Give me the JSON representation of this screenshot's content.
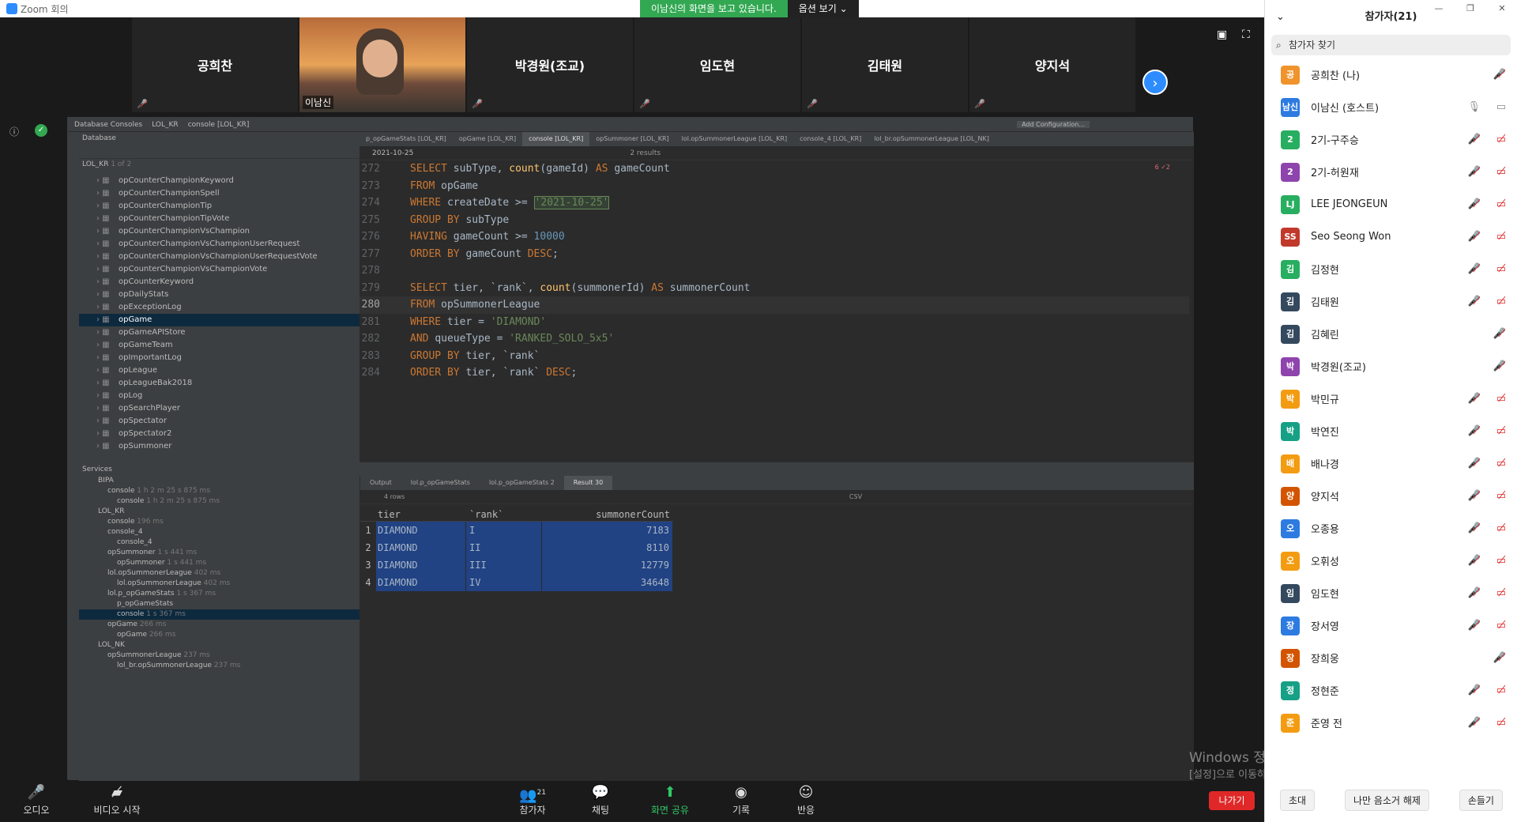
{
  "window": {
    "title": "Zoom 회의"
  },
  "share_banner": {
    "text": "이남신의 화면을 보고 있습니다.",
    "options": "옵션 보기"
  },
  "panel_window_controls": {
    "min": "—",
    "max": "❐",
    "close": "✕"
  },
  "video_tiles": [
    {
      "name": "공희찬",
      "video": false
    },
    {
      "name": "이남신",
      "video": true
    },
    {
      "name": "박경원(조교)",
      "video": false
    },
    {
      "name": "임도현",
      "video": false
    },
    {
      "name": "김태원",
      "video": false
    },
    {
      "name": "양지석",
      "video": false
    }
  ],
  "ide": {
    "breadcrumb": [
      "Database Consoles",
      "LOL_KR",
      "console [LOL_KR]"
    ],
    "add_config": "Add Configuration...",
    "db_panel_title": "Database",
    "db_root": "LOL_KR",
    "db_root_count": "1 of 2",
    "tables": [
      "opCounterChampionKeyword",
      "opCounterChampionSpell",
      "opCounterChampionTip",
      "opCounterChampionTipVote",
      "opCounterChampionVsChampion",
      "opCounterChampionVsChampionUserRequest",
      "opCounterChampionVsChampionUserRequestVote",
      "opCounterChampionVsChampionVote",
      "opCounterKeyword",
      "opDailyStats",
      "opExceptionLog",
      "opGame",
      "opGameAPIStore",
      "opGameTeam",
      "opImportantLog",
      "opLeague",
      "opLeagueBak2018",
      "opLog",
      "opSearchPlayer",
      "opSpectator",
      "opSpectator2",
      "opSummoner"
    ],
    "tabs": [
      "p_opGameStats [LOL_KR]",
      "opGame [LOL_KR]",
      "console [LOL_KR]",
      "opSummoner [LOL_KR]",
      "lol.opSummonerLeague [LOL_KR]",
      "console_4 [LOL_KR]",
      "lol_br.opSummonerLeague [LOL_NK]"
    ],
    "search_value": "2021-10-25",
    "search_results": "2 results",
    "inspection": "6 ✓2",
    "code_lines": [
      {
        "n": "272",
        "parts": [
          [
            "kw",
            "SELECT "
          ],
          [
            "",
            "subType, "
          ],
          [
            "fn",
            "count"
          ],
          [
            "",
            "(gameId) "
          ],
          [
            "kw",
            "AS "
          ],
          [
            "",
            "gameCount"
          ]
        ]
      },
      {
        "n": "273",
        "parts": [
          [
            "kw",
            "FROM "
          ],
          [
            "",
            "opGame"
          ]
        ]
      },
      {
        "n": "274",
        "parts": [
          [
            "kw",
            "WHERE "
          ],
          [
            "",
            "createDate >= "
          ],
          [
            "st hl",
            "'2021-10-25'"
          ]
        ]
      },
      {
        "n": "275",
        "parts": [
          [
            "kw",
            "GROUP BY "
          ],
          [
            "",
            "subType"
          ]
        ]
      },
      {
        "n": "276",
        "parts": [
          [
            "kw",
            "HAVING "
          ],
          [
            "",
            "gameCount >= "
          ],
          [
            "nm2",
            "10000"
          ]
        ]
      },
      {
        "n": "277",
        "parts": [
          [
            "kw",
            "ORDER BY "
          ],
          [
            "",
            "gameCount "
          ],
          [
            "kw",
            "DESC"
          ],
          [
            "",
            ";"
          ]
        ]
      },
      {
        "n": "278",
        "parts": []
      },
      {
        "n": "279",
        "parts": [
          [
            "kw",
            "SELECT "
          ],
          [
            "",
            "tier, `rank`, "
          ],
          [
            "fn",
            "count"
          ],
          [
            "",
            "(summonerId) "
          ],
          [
            "kw",
            "AS "
          ],
          [
            "",
            "summonerCount"
          ]
        ]
      },
      {
        "n": "280",
        "parts": [
          [
            "kw",
            "FROM "
          ],
          [
            "",
            "opSummonerLeague"
          ]
        ]
      },
      {
        "n": "281",
        "parts": [
          [
            "kw",
            "WHERE "
          ],
          [
            "",
            "tier = "
          ],
          [
            "st",
            "'DIAMOND'"
          ]
        ]
      },
      {
        "n": "282",
        "parts": [
          [
            "kw",
            "AND "
          ],
          [
            "",
            "queueType = "
          ],
          [
            "st",
            "'RANKED_SOLO_5x5'"
          ]
        ]
      },
      {
        "n": "283",
        "parts": [
          [
            "kw",
            "GROUP BY "
          ],
          [
            "",
            "tier, `rank`"
          ]
        ]
      },
      {
        "n": "284",
        "parts": [
          [
            "kw",
            "ORDER BY "
          ],
          [
            "",
            "tier, `rank` "
          ],
          [
            "kw",
            "DESC"
          ],
          [
            "",
            ";"
          ]
        ]
      }
    ],
    "services_title": "Services",
    "services": [
      {
        "d": 1,
        "label": "BIPA",
        "t": ""
      },
      {
        "d": 2,
        "label": "console",
        "t": "1 h 2 m 25 s 875 ms"
      },
      {
        "d": 3,
        "label": "console",
        "t": "1 h 2 m 25 s 875 ms"
      },
      {
        "d": 1,
        "label": "LOL_KR",
        "t": ""
      },
      {
        "d": 2,
        "label": "console",
        "t": "196 ms"
      },
      {
        "d": 2,
        "label": "console_4",
        "t": ""
      },
      {
        "d": 3,
        "label": "console_4",
        "t": ""
      },
      {
        "d": 2,
        "label": "opSummoner",
        "t": "1 s 441 ms"
      },
      {
        "d": 3,
        "label": "opSummoner",
        "t": "1 s 441 ms"
      },
      {
        "d": 2,
        "label": "lol.opSummonerLeague",
        "t": "402 ms"
      },
      {
        "d": 3,
        "label": "lol.opSummonerLeague",
        "t": "402 ms"
      },
      {
        "d": 2,
        "label": "lol.p_opGameStats",
        "t": "1 s 367 ms"
      },
      {
        "d": 3,
        "label": "p_opGameStats",
        "t": ""
      },
      {
        "d": 3,
        "label": "console",
        "t": "1 s 367 ms",
        "sel": true
      },
      {
        "d": 2,
        "label": "opGame",
        "t": "266 ms"
      },
      {
        "d": 3,
        "label": "opGame",
        "t": "266 ms"
      },
      {
        "d": 1,
        "label": "LOL_NK",
        "t": ""
      },
      {
        "d": 2,
        "label": "opSummonerLeague",
        "t": "237 ms"
      },
      {
        "d": 3,
        "label": "lol_br.opSummonerLeague",
        "t": "237 ms"
      }
    ],
    "result_tabs": [
      "Output",
      "lol.p_opGameStats",
      "lol.p_opGameStats 2",
      "Result 30"
    ],
    "rows_label": "4 rows",
    "export": "CSV",
    "columns": [
      "tier",
      "`rank`",
      "summonerCount"
    ],
    "rows": [
      [
        "1",
        "DIAMOND",
        "I",
        "7183"
      ],
      [
        "2",
        "DIAMOND",
        "II",
        "8110"
      ],
      [
        "3",
        "DIAMOND",
        "III",
        "12779"
      ],
      [
        "4",
        "DIAMOND",
        "IV",
        "34648"
      ]
    ]
  },
  "watermark": {
    "line1": "Windows 정품 인증",
    "line2": "[설정]으로 이동하여 Windows를 정품 인증합니다."
  },
  "bottom_bar": {
    "audio": "오디오",
    "video": "비디오 시작",
    "participants": "참가자",
    "participant_count": "21",
    "chat": "채팅",
    "share": "화면 공유",
    "record": "기록",
    "reactions": "반응",
    "leave": "나가기"
  },
  "panel": {
    "title": "참가자(21)",
    "search_placeholder": "참가자 찾기",
    "participants": [
      {
        "av": "공",
        "name": "공희찬 (나)",
        "color": "#f0932b",
        "cam": false
      },
      {
        "av": "남신",
        "name": "이남신 (호스트)",
        "color": "#2d7be0",
        "cam": false,
        "host": true
      },
      {
        "av": "2",
        "name": "2기-구주승",
        "color": "#27ae60",
        "cam": true
      },
      {
        "av": "2",
        "name": "2기-허원재",
        "color": "#8e44ad",
        "cam": true
      },
      {
        "av": "LJ",
        "name": "LEE JEONGEUN",
        "color": "#27ae60",
        "cam": true
      },
      {
        "av": "SS",
        "name": "Seo Seong Won",
        "color": "#c0392b",
        "cam": true
      },
      {
        "av": "김",
        "name": "김정현",
        "color": "#27ae60",
        "cam": true
      },
      {
        "av": "김",
        "name": "김태원",
        "color": "#34495e",
        "cam": true
      },
      {
        "av": "김",
        "name": "김혜린",
        "color": "#34495e",
        "cam": false
      },
      {
        "av": "박",
        "name": "박경원(조교)",
        "color": "#8e44ad",
        "cam": false
      },
      {
        "av": "박",
        "name": "박민규",
        "color": "#f39c12",
        "cam": true
      },
      {
        "av": "박",
        "name": "박연진",
        "color": "#16a085",
        "cam": true
      },
      {
        "av": "배",
        "name": "배나경",
        "color": "#f39c12",
        "cam": true
      },
      {
        "av": "양",
        "name": "양지석",
        "color": "#d35400",
        "cam": true
      },
      {
        "av": "오",
        "name": "오종용",
        "color": "#2d7be0",
        "cam": true
      },
      {
        "av": "오",
        "name": "오휘성",
        "color": "#f39c12",
        "cam": true
      },
      {
        "av": "임",
        "name": "임도현",
        "color": "#34495e",
        "cam": true
      },
      {
        "av": "장",
        "name": "장서영",
        "color": "#2d7be0",
        "cam": true
      },
      {
        "av": "장",
        "name": "장희웅",
        "color": "#d35400",
        "cam": false
      },
      {
        "av": "정",
        "name": "정현준",
        "color": "#16a085",
        "cam": true
      },
      {
        "av": "준",
        "name": "준영 전",
        "color": "#f39c12",
        "cam": true
      }
    ],
    "footer": {
      "invite": "초대",
      "unmute": "나만 음소거 해제",
      "raise": "손들기"
    }
  }
}
